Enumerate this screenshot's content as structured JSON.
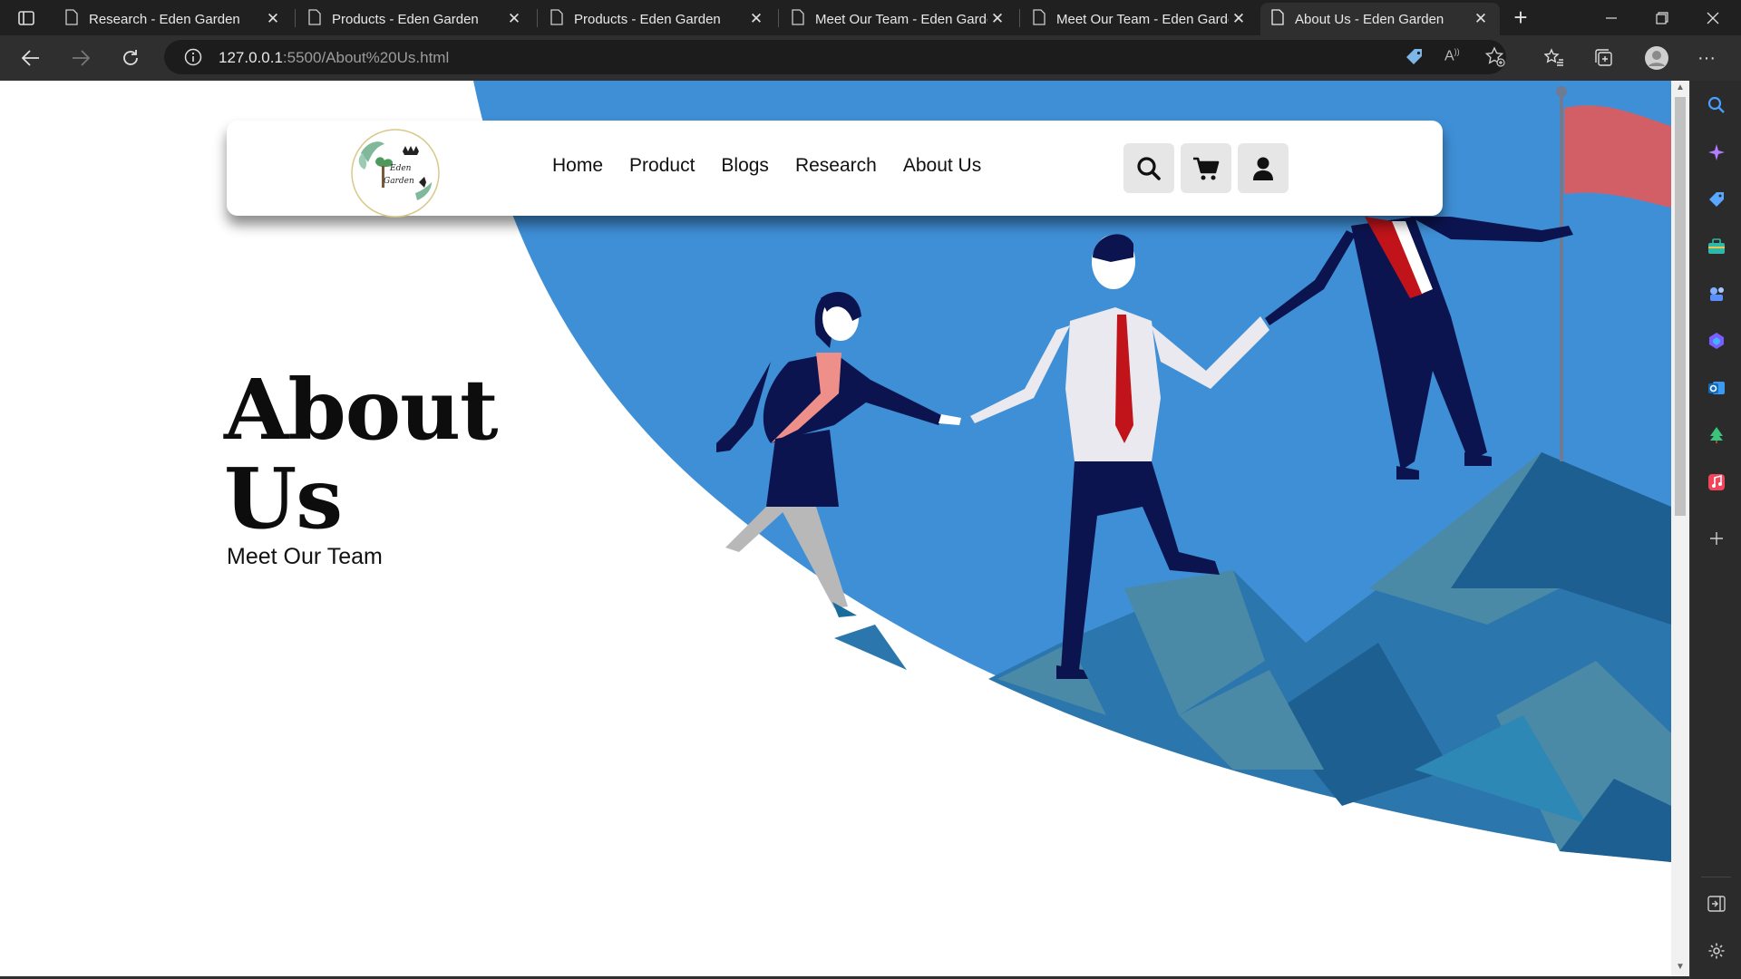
{
  "browser": {
    "tabs": [
      {
        "title": "Research - Eden Garden",
        "active": false
      },
      {
        "title": "Products - Eden Garden",
        "active": false
      },
      {
        "title": "Products - Eden Garden",
        "active": false
      },
      {
        "title": "Meet Our Team - Eden Garden",
        "active": false
      },
      {
        "title": "Meet Our Team - Eden Garden",
        "active": false
      },
      {
        "title": "About Us - Eden Garden",
        "active": true
      }
    ],
    "close_glyph": "✕",
    "newtab_glyph": "+",
    "address": {
      "host": "127.0.0.1",
      "rest": ":5500/About%20Us.html"
    }
  },
  "site": {
    "logo_text_line1": "Eden",
    "logo_text_line2": "Garden",
    "nav": [
      "Home",
      "Product",
      "Blogs",
      "Research",
      "About Us"
    ],
    "action_icons": [
      "search-icon",
      "cart-icon",
      "user-icon"
    ],
    "hero_title_line1": "About",
    "hero_title_line2": "Us",
    "hero_subtitle": "Meet Our Team"
  },
  "colors": {
    "hero_blue": "#3f8fd6",
    "mountain_dark": "#1e5f92",
    "mountain_mid": "#2b77ad",
    "mountain_light": "#4a8aa6",
    "flag": "#d35f66",
    "suit_navy": "#0c1450",
    "tie_red": "#c0141a",
    "blouse_pink": "#ef8f8a"
  }
}
